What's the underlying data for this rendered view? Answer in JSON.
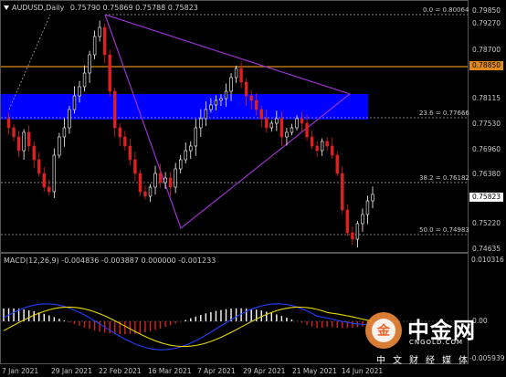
{
  "header": {
    "symbol": "AUDUSD,Daily",
    "ohlc": "0.75790 0.75869 0.75788 0.75823"
  },
  "macd": {
    "label": "MACD(12,26,9) -0.004836 -0.003887 0.000000 -0.001233"
  },
  "price_axis": {
    "ticks": [
      "0.79850",
      "0.79270",
      "0.78700",
      "0.78115",
      "0.77530",
      "0.76960",
      "0.76380",
      "0.75220",
      "0.74635"
    ],
    "highlight_orange": "0.78850",
    "current_price": "0.75823"
  },
  "macd_axis": {
    "ticks": [
      "0.010316",
      "0.00",
      "-0.005939"
    ]
  },
  "fib_levels": [
    {
      "label": "0.0 = 0.80064"
    },
    {
      "label": "23.6 = 0.77666"
    },
    {
      "label": "38.2 = 0.76182"
    },
    {
      "label": "50.0 = 0.74983"
    }
  ],
  "date_axis": {
    "ticks": [
      "7 Jan 2021",
      "29 Jan 2021",
      "22 Feb 2021",
      "16 Mar 2021",
      "7 Apr 2021",
      "29 Apr 2021",
      "21 May 2021",
      "14 Jun 2021"
    ]
  },
  "watermark": {
    "brand": "中金网",
    "domain": "CNGOLD.COM",
    "tagline": "中文财经媒体"
  },
  "colors": {
    "bull": "#ffffff",
    "bear": "#e02020",
    "zone": "#0000ff",
    "orange_line": "#e08a1e",
    "triangle": "#9b30d0",
    "macd_main": "#1f3fff",
    "macd_signal": "#e8d800",
    "grid": "#444444"
  }
}
